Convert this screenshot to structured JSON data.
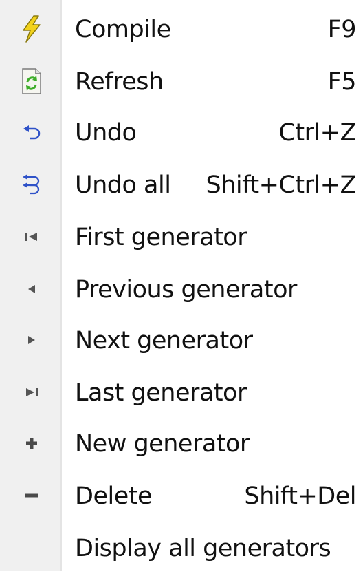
{
  "menu": {
    "items": [
      {
        "label": "Compile",
        "shortcut": "F9",
        "icon": "lightning-icon"
      },
      {
        "label": "Refresh",
        "shortcut": "F5",
        "icon": "refresh-icon"
      },
      {
        "label": "Undo",
        "shortcut": "Ctrl+Z",
        "icon": "undo-icon"
      },
      {
        "label": "Undo all",
        "shortcut": "Shift+Ctrl+Z",
        "icon": "undo-all-icon"
      },
      {
        "label": "First generator",
        "shortcut": "",
        "icon": "first-icon"
      },
      {
        "label": "Previous generator",
        "shortcut": "",
        "icon": "previous-icon"
      },
      {
        "label": "Next generator",
        "shortcut": "",
        "icon": "next-icon"
      },
      {
        "label": "Last generator",
        "shortcut": "",
        "icon": "last-icon"
      },
      {
        "label": "New generator",
        "shortcut": "",
        "icon": "plus-icon"
      },
      {
        "label": "Delete",
        "shortcut": "Shift+Del",
        "icon": "minus-icon"
      },
      {
        "label": "Display all generators",
        "shortcut": "",
        "icon": ""
      }
    ]
  },
  "colors": {
    "gutter": "#f0f0f0",
    "text": "#111111",
    "lightning": "#f2d21b",
    "refresh_green": "#3fae2a",
    "undo_blue": "#2f52c8",
    "nav_gray": "#555555"
  }
}
